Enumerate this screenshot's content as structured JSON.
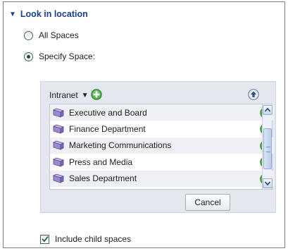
{
  "section": {
    "title": "Look in location"
  },
  "radios": [
    {
      "label": "All Spaces",
      "checked": false
    },
    {
      "label": "Specify Space:",
      "checked": true
    }
  ],
  "picker": {
    "current": "Intranet",
    "items": [
      {
        "label": "Executive and Board"
      },
      {
        "label": "Finance Department"
      },
      {
        "label": "Marketing Communications"
      },
      {
        "label": "Press and Media"
      },
      {
        "label": "Sales Department"
      }
    ],
    "cancel_label": "Cancel"
  },
  "include_child": {
    "label": "Include child spaces",
    "checked": true
  },
  "colors": {
    "header": "#15428b",
    "panel_bg": "#e3e7ee",
    "plus_green": "#3fa33a"
  }
}
